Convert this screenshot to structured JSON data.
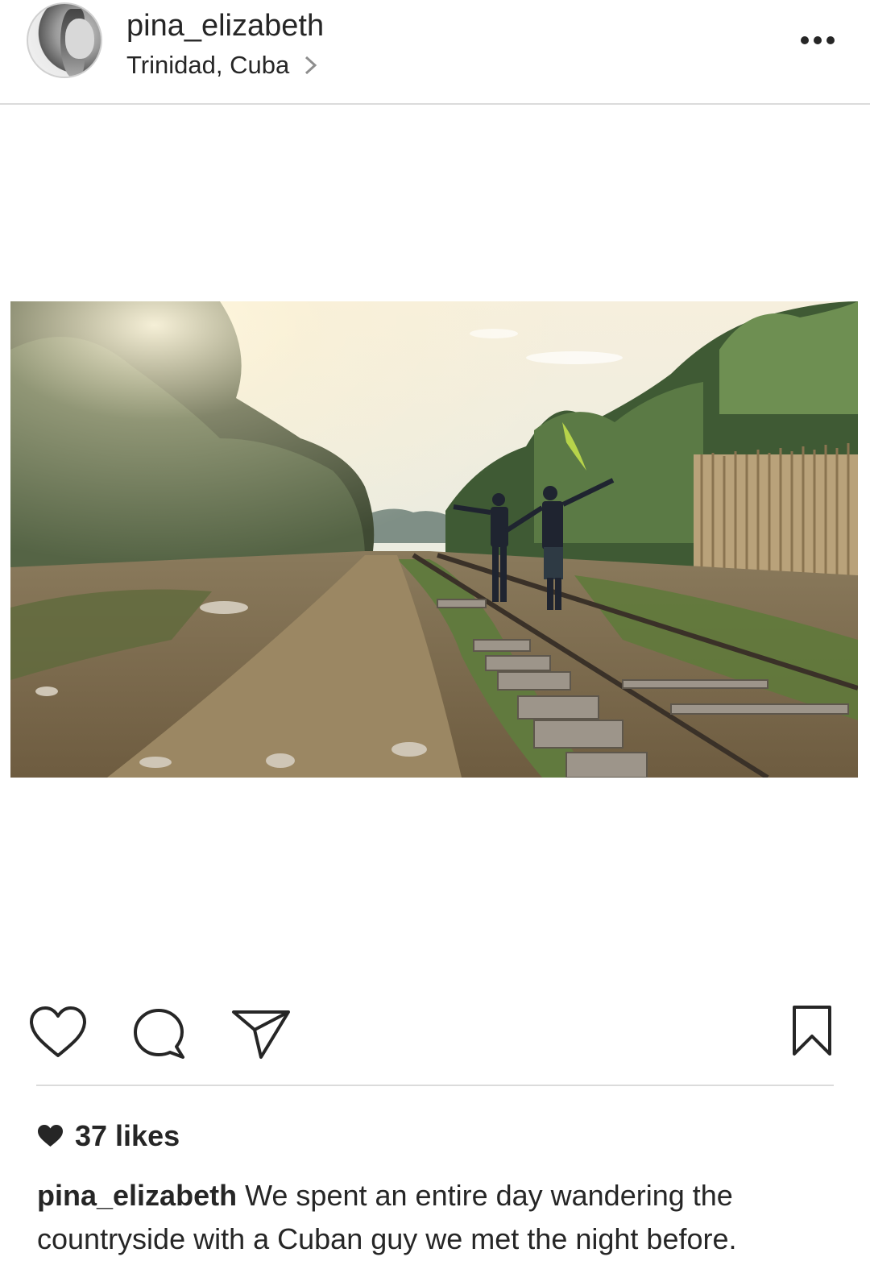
{
  "post": {
    "username": "pina_elizabeth",
    "location": "Trinidad, Cuba",
    "likes_count": "37",
    "likes_label": "likes",
    "caption_user": "pina_elizabeth",
    "caption_line1": "We spent an entire day wandering the",
    "caption_line2": "countryside with a Cuban guy we met the night before."
  },
  "icons": {
    "avatar": "profile-photo",
    "location_chevron": "chevron-right-icon",
    "more": "more-options-icon",
    "like": "heart-outline-icon",
    "comment": "comment-bubble-icon",
    "share": "paper-plane-icon",
    "save": "bookmark-icon",
    "likes_heart": "heart-filled-icon"
  },
  "colors": {
    "text": "#262626",
    "divider": "#dbdbdb",
    "background": "#ffffff"
  }
}
